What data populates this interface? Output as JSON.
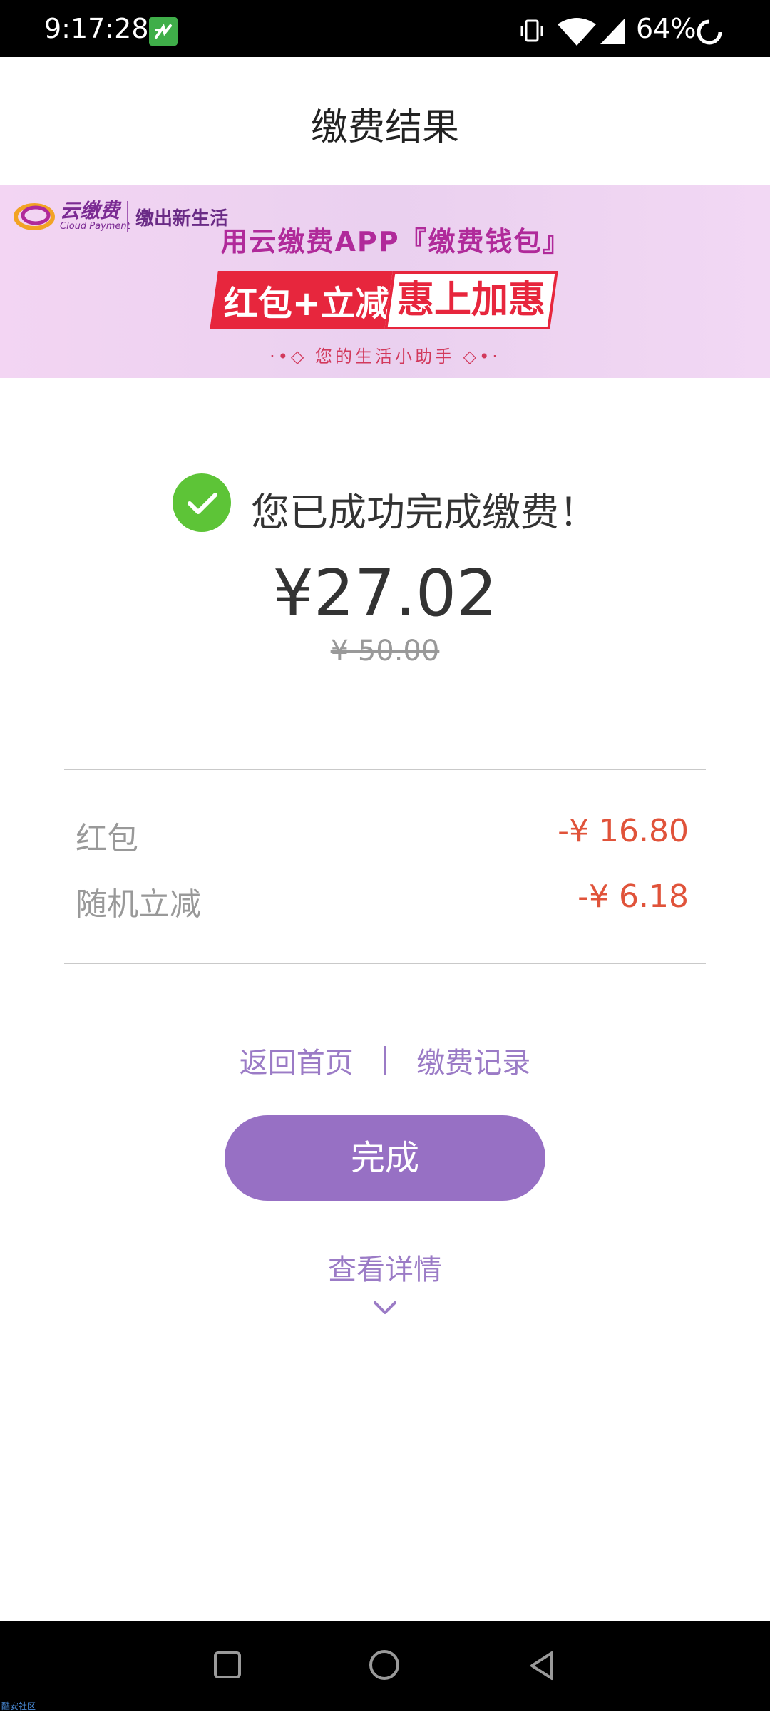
{
  "status_bar": {
    "time": "9:17:28",
    "battery": "64%",
    "icons": [
      "app-notification-icon",
      "vibrate-icon",
      "wifi-icon",
      "signal-icon",
      "battery-saver-icon"
    ]
  },
  "header": {
    "title": "缴费结果"
  },
  "banner": {
    "brand": "云缴费",
    "brand_en": "Cloud Payment",
    "slogan": "缴出新生活",
    "headline": "用云缴费APP『缴费钱包』",
    "tag_red": "红包+立减",
    "tag_white": "惠上加惠",
    "subline": "·•◇ 您的生活小助手 ◇•·"
  },
  "result": {
    "message": "您已成功完成缴费！",
    "amount": "¥27.02",
    "original_amount": "¥ 50.00"
  },
  "discounts": [
    {
      "label": "红包",
      "value": "-¥ 16.80"
    },
    {
      "label": "随机立减",
      "value": "-¥ 6.18"
    }
  ],
  "links": {
    "home": "返回首页",
    "records": "缴费记录"
  },
  "done_button": "完成",
  "details_link": "查看详情",
  "watermark": "酷安社区",
  "colors": {
    "accent": "#9770c4",
    "success": "#5dc437",
    "discount": "#e0533a",
    "banner_red": "#e7263d"
  }
}
